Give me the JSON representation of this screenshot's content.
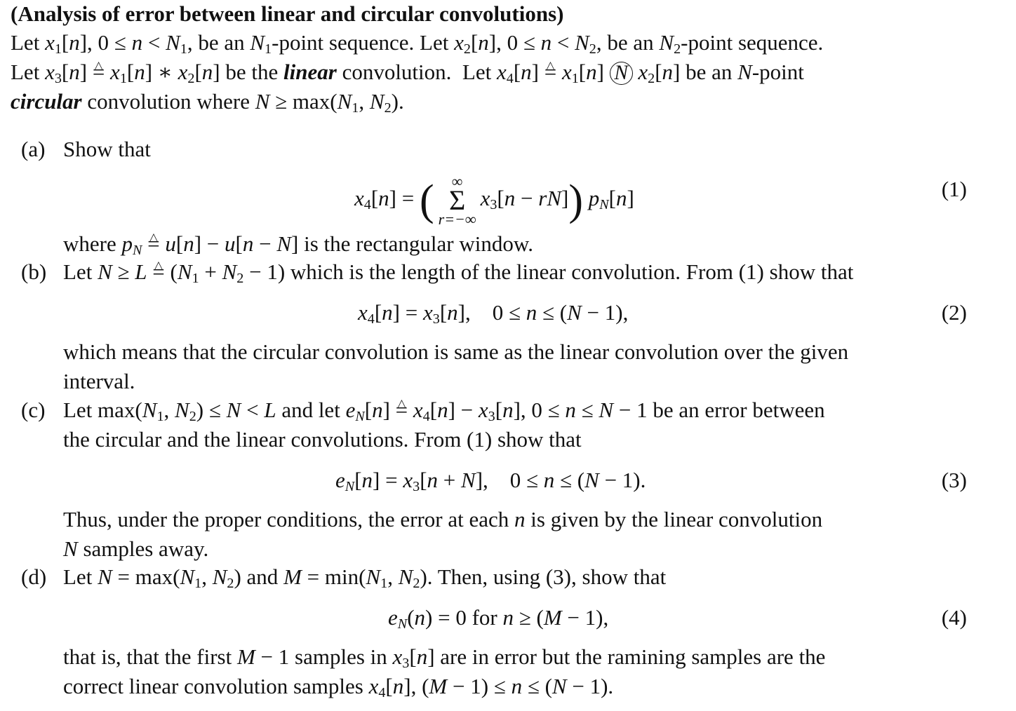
{
  "title": "(Analysis of error between linear and circular convolutions)",
  "intro": {
    "line1": {
      "t1": "Let ",
      "x1": "x",
      "s1": "1",
      "t2": "[n], 0 ≤ n < N",
      "s2": "1",
      "t3": ", be an N",
      "s3": "1",
      "t4": "-point sequence. Let x",
      "s4": "2",
      "t5": "[n], 0 ≤ n < N",
      "s5": "2",
      "t6": ", be an N",
      "s6": "2",
      "t7": "-point sequence."
    },
    "line2_text": "Let x3[n] ≜ x1[n] ∗ x2[n] be the linear convolution. Let x4[n] ≜ x1[n] Ⓝ x2[n] be an N-point",
    "line3_text": "circular convolution where N ≥ max(N1, N2).",
    "emph_linear": "linear",
    "emph_circular": "circular"
  },
  "parts": [
    {
      "label": "(a)",
      "text": "Show that",
      "equation": "x4[n] = ( Σ_{r=−∞}^{∞} x3[n − rN] ) pN[n]",
      "equation_number": "(1)",
      "after": "where pN ≜ u[n] − u[n − N] is the rectangular window."
    },
    {
      "label": "(b)",
      "text": "Let N ≥ L ≜ (N1 + N2 − 1) which is the length of the linear convolution. From (1) show that",
      "equation": "x4[n] = x3[n],   0 ≤ n ≤ (N − 1),",
      "equation_number": "(2)",
      "after_lines": [
        "which means that the circular convolution is same as the linear convolution over the given",
        "interval."
      ]
    },
    {
      "label": "(c)",
      "text_lines": [
        "Let max(N1, N2) ≤ N < L and let eN[n] ≜ x4[n] − x3[n], 0 ≤ n ≤ N − 1 be an error between",
        "the circular and the linear convolutions. From (1) show that"
      ],
      "equation": "eN[n] = x3[n + N],   0 ≤ n ≤ (N − 1).",
      "equation_number": "(3)",
      "after_lines": [
        "Thus, under the proper conditions, the error at each n is given by the linear convolution",
        "N samples away."
      ]
    },
    {
      "label": "(d)",
      "text": "Let N = max(N1, N2) and M = min(N1, N2). Then, using (3), show that",
      "equation": "eN(n) = 0 for n ≥ (M − 1),",
      "equation_number": "(4)",
      "after_lines": [
        "that is, that the first M − 1 samples in x3[n] are in error but the ramining samples are the",
        "correct linear convolution samples x4[n], (M − 1) ≤ n ≤ (N − 1)."
      ]
    }
  ],
  "sum": {
    "upper": "∞",
    "lower": "r=−∞",
    "symbol": "Σ"
  }
}
